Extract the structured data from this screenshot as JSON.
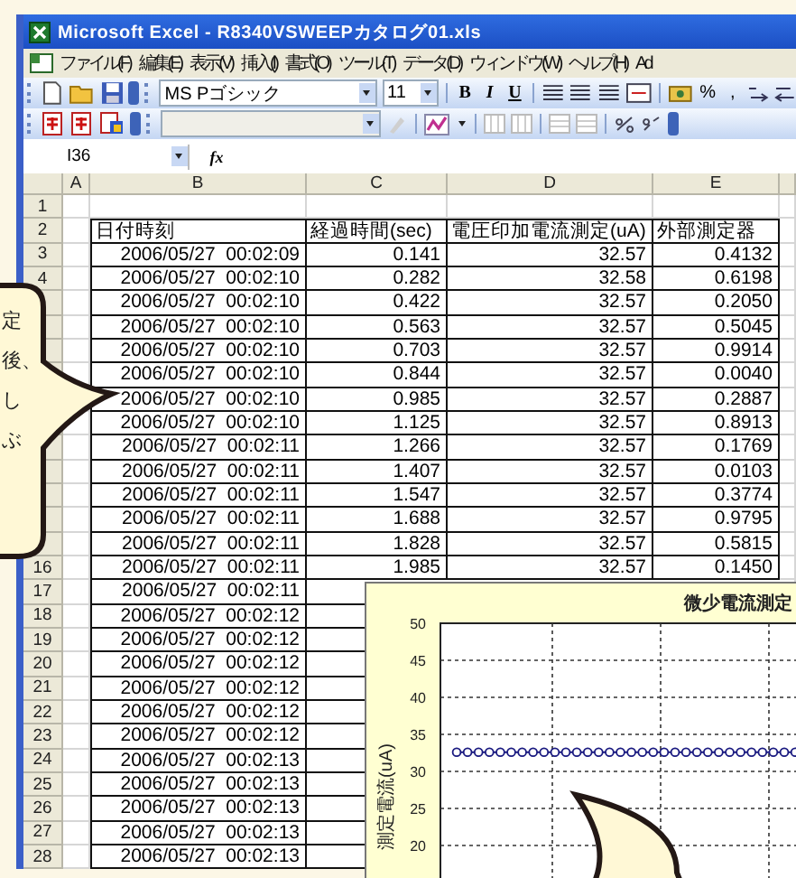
{
  "window": {
    "title": "Microsoft Excel - R8340VSWEEPカタログ01.xls"
  },
  "menu": [
    "ファイル(F)",
    "編集(E)",
    "表示(V)",
    "挿入(I)",
    "書式(O)",
    "ツール(T)",
    "データ(D)",
    "ウィンドウ(W)",
    "ヘルプ(H)",
    "Ad"
  ],
  "toolbar": {
    "font_name": "MS Pゴシック",
    "font_size": "11",
    "format_buttons": [
      "B",
      "I",
      "U"
    ],
    "percent": "%",
    "comma": ","
  },
  "formula_bar": {
    "name_box": "I36",
    "fx": "fx"
  },
  "columns": [
    "A",
    "B",
    "C",
    "D",
    "E"
  ],
  "rows": [
    {
      "num": "1",
      "cells": []
    },
    {
      "num": "2",
      "cells": [
        "日付時刻",
        "経過時間(sec)",
        "電圧印加電流測定(uA)",
        "外部測定器"
      ]
    },
    {
      "num": "3",
      "cells": [
        "2006/05/27  00:02:09",
        "0.141",
        "32.57",
        "0.4132"
      ]
    },
    {
      "num": "4",
      "cells": [
        "2006/05/27  00:02:10",
        "0.282",
        "32.58",
        "0.6198"
      ]
    },
    {
      "cells": [
        "2006/05/27  00:02:10",
        "0.422",
        "32.57",
        "0.2050"
      ]
    },
    {
      "cells": [
        "2006/05/27  00:02:10",
        "0.563",
        "32.57",
        "0.5045"
      ]
    },
    {
      "cells": [
        "2006/05/27  00:02:10",
        "0.703",
        "32.57",
        "0.9914"
      ]
    },
    {
      "cells": [
        "2006/05/27  00:02:10",
        "0.844",
        "32.57",
        "0.0040"
      ]
    },
    {
      "cells": [
        "2006/05/27  00:02:10",
        "0.985",
        "32.57",
        "0.2887"
      ]
    },
    {
      "cells": [
        "2006/05/27  00:02:10",
        "1.125",
        "32.57",
        "0.8913"
      ]
    },
    {
      "cells": [
        "2006/05/27  00:02:11",
        "1.266",
        "32.57",
        "0.1769"
      ]
    },
    {
      "cells": [
        "2006/05/27  00:02:11",
        "1.407",
        "32.57",
        "0.0103"
      ]
    },
    {
      "cells": [
        "2006/05/27  00:02:11",
        "1.547",
        "32.57",
        "0.3774"
      ]
    },
    {
      "cells": [
        "2006/05/27  00:02:11",
        "1.688",
        "32.57",
        "0.9795"
      ]
    },
    {
      "cells": [
        "2006/05/27  00:02:11",
        "1.828",
        "32.57",
        "0.5815"
      ]
    },
    {
      "num": "16",
      "cells": [
        "2006/05/27  00:02:11",
        "1.985",
        "32.57",
        "0.1450"
      ]
    },
    {
      "num": "17",
      "cells": [
        "2006/05/27  00:02:11"
      ]
    },
    {
      "num": "18",
      "cells": [
        "2006/05/27  00:02:12"
      ]
    },
    {
      "num": "19",
      "cells": [
        "2006/05/27  00:02:12"
      ]
    },
    {
      "num": "20",
      "cells": [
        "2006/05/27  00:02:12"
      ]
    },
    {
      "num": "21",
      "cells": [
        "2006/05/27  00:02:12"
      ]
    },
    {
      "num": "22",
      "cells": [
        "2006/05/27  00:02:12"
      ]
    },
    {
      "num": "23",
      "cells": [
        "2006/05/27  00:02:12"
      ]
    },
    {
      "num": "24",
      "cells": [
        "2006/05/27  00:02:13"
      ]
    },
    {
      "num": "25",
      "cells": [
        "2006/05/27  00:02:13"
      ]
    },
    {
      "num": "26",
      "cells": [
        "2006/05/27  00:02:13"
      ]
    },
    {
      "num": "27",
      "cells": [
        "2006/05/27  00:02:13"
      ]
    },
    {
      "num": "28",
      "cells": [
        "2006/05/27  00:02:13"
      ]
    }
  ],
  "callout": {
    "lines": [
      "定",
      "後、",
      "し",
      "ぶ"
    ]
  },
  "chart": {
    "chart_data": {
      "type": "line",
      "title": "微少電流測定",
      "ylabel": "測定電流(uA)",
      "ylim": [
        15,
        50
      ],
      "yticks": [
        20,
        25,
        30,
        35,
        40,
        45,
        50
      ],
      "grid": true,
      "marker": "circle",
      "values": [
        32.6,
        32.6,
        32.6,
        32.6,
        32.6,
        32.6,
        32.6,
        32.6,
        32.6,
        32.6,
        32.6,
        32.6,
        32.6,
        32.6,
        32.6,
        32.6,
        32.6,
        32.6,
        32.6,
        32.6,
        32.6,
        32.6,
        32.6,
        32.6,
        32.6,
        32.6,
        32.6,
        32.6,
        32.6,
        32.6,
        32.6,
        32.6
      ]
    }
  }
}
